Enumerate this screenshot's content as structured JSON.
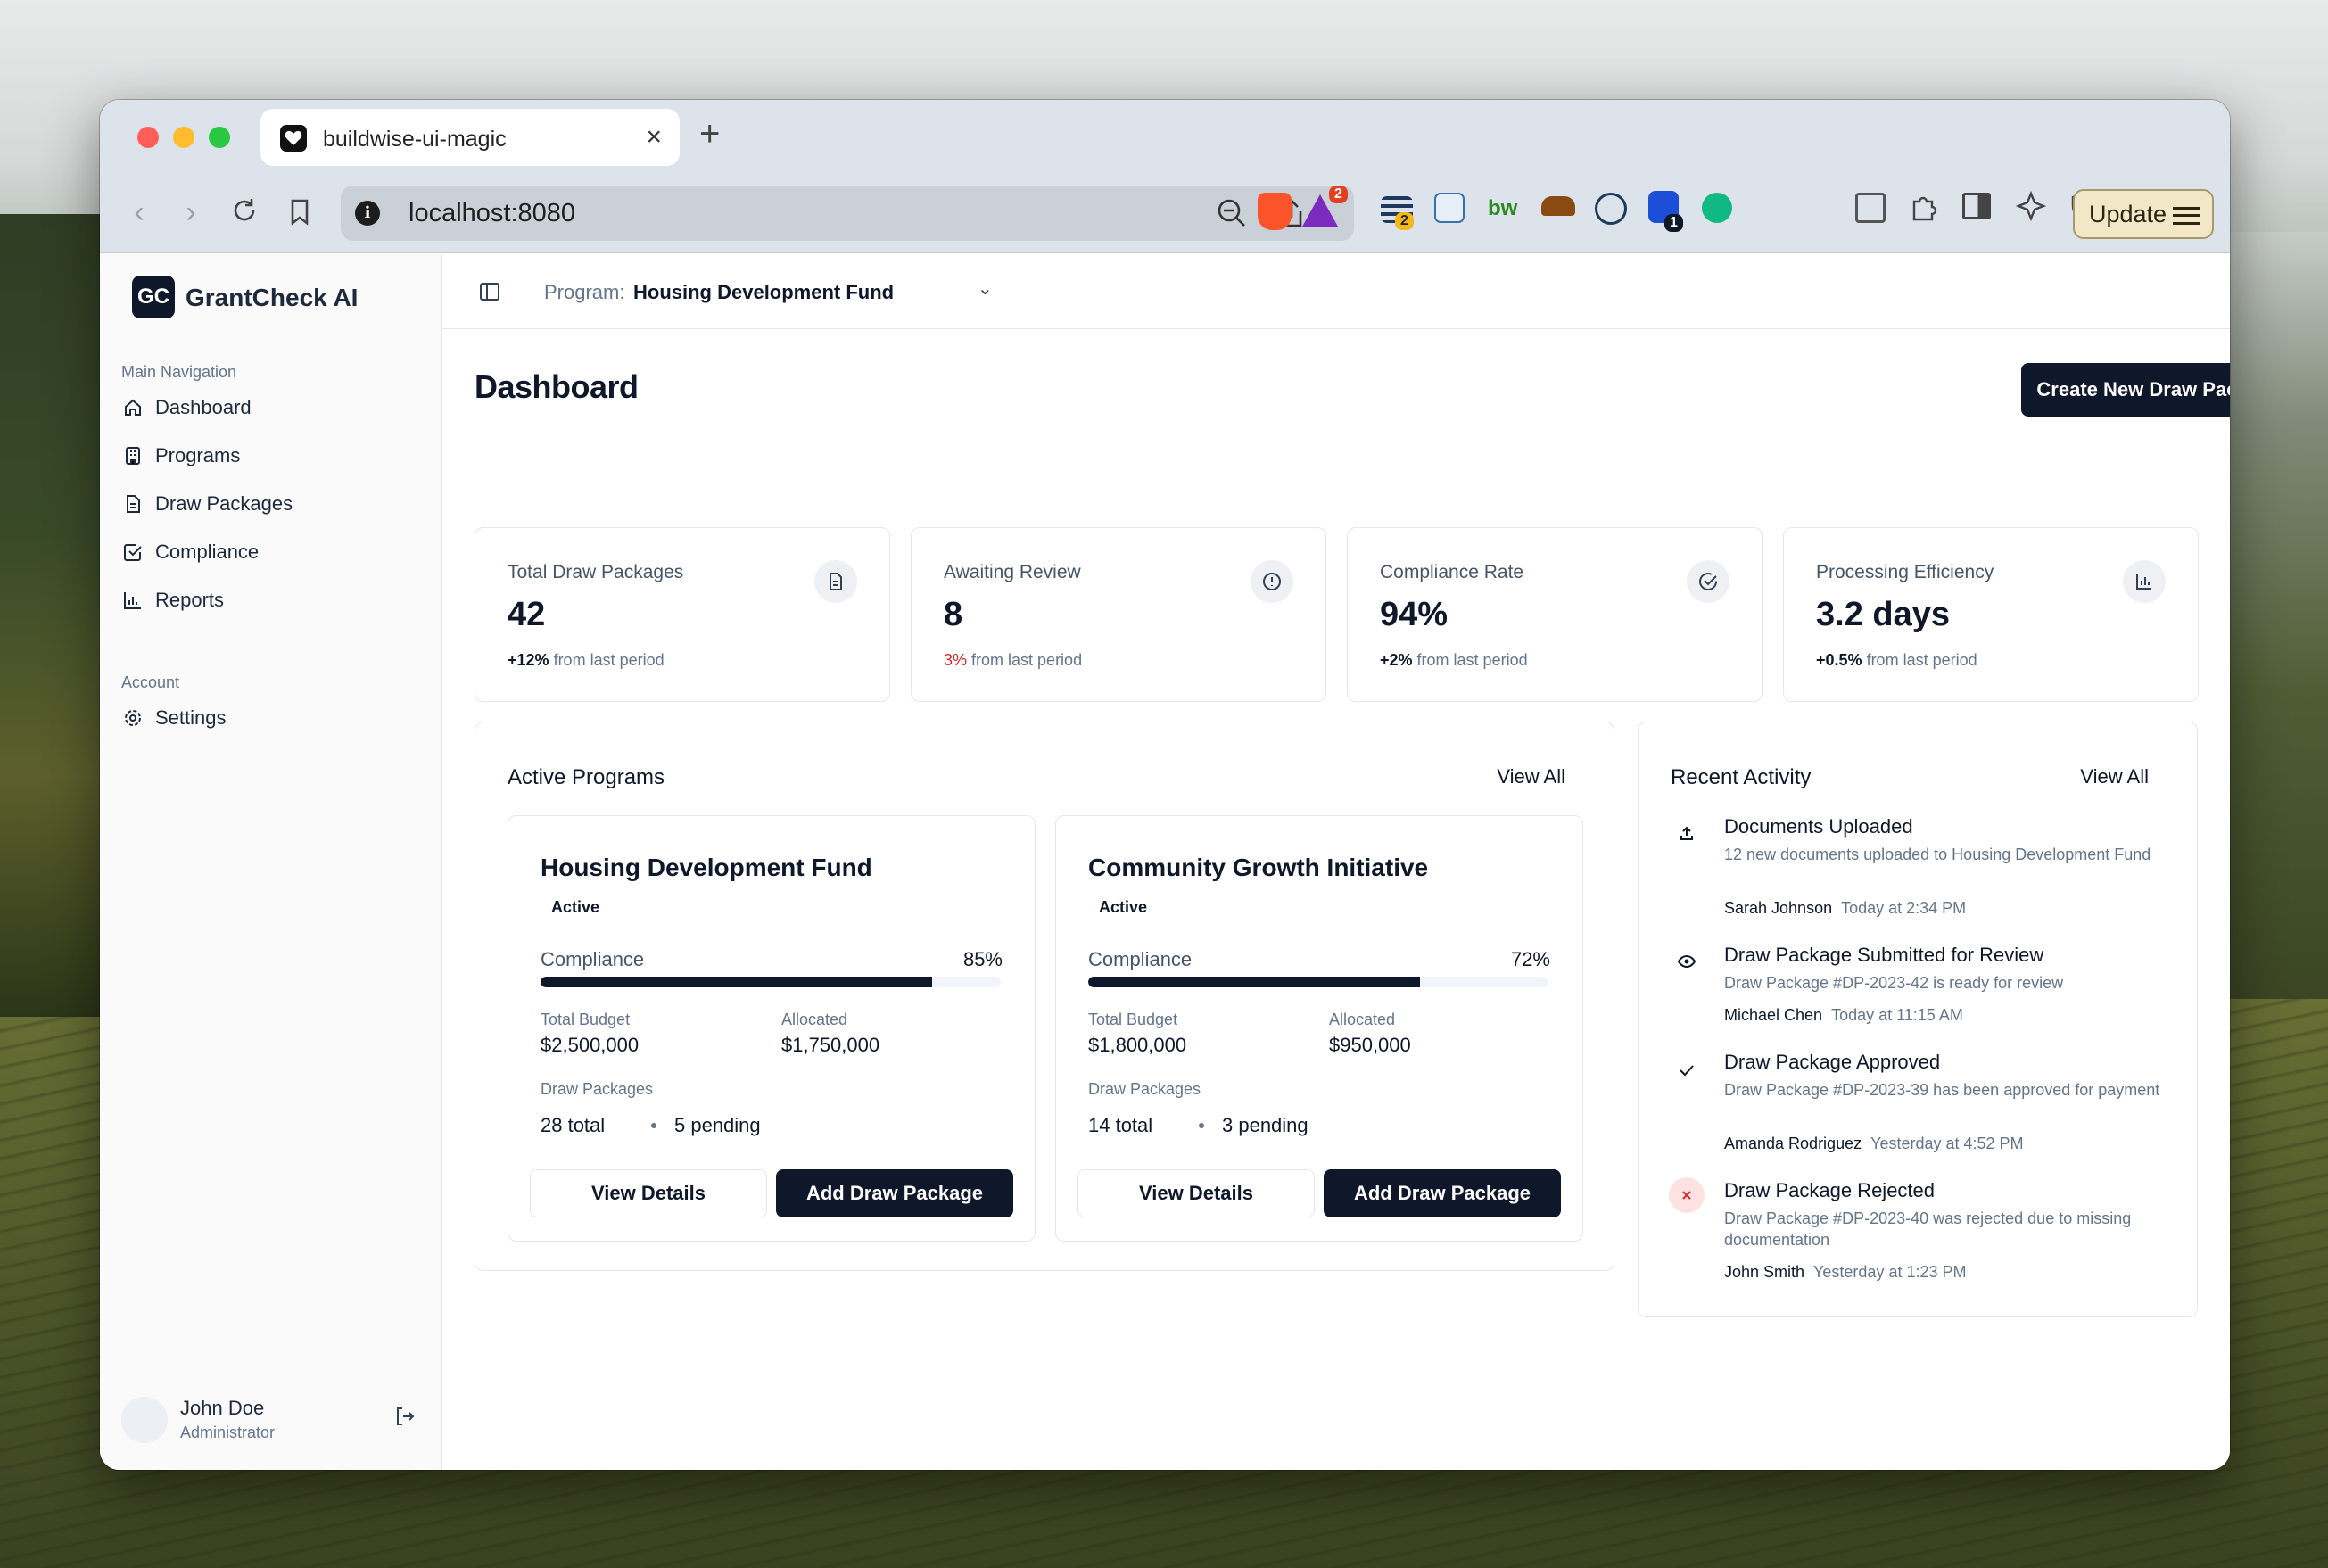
{
  "browser": {
    "tab_title": "buildwise-ui-magic",
    "url": "localhost:8080",
    "ext_badge_1": "2",
    "ext_badge_2": "2",
    "ext_badge_3": "1",
    "update_label": "Update"
  },
  "sidebar": {
    "logo_initials": "GC",
    "brand": "GrantCheck AI",
    "section_main": "Main Navigation",
    "items": [
      {
        "label": "Dashboard",
        "icon": "home-icon"
      },
      {
        "label": "Programs",
        "icon": "building-icon"
      },
      {
        "label": "Draw Packages",
        "icon": "file-icon"
      },
      {
        "label": "Compliance",
        "icon": "check-square-icon"
      },
      {
        "label": "Reports",
        "icon": "bar-chart-icon"
      }
    ],
    "section_account": "Account",
    "settings_label": "Settings",
    "user": {
      "name": "John Doe",
      "role": "Administrator"
    }
  },
  "topbar": {
    "program_label": "Program:",
    "program_value": "Housing Development Fund"
  },
  "page": {
    "title": "Dashboard",
    "create_button": "Create New Draw Package"
  },
  "stats": [
    {
      "label": "Total Draw Packages",
      "value": "42",
      "change": "+12%",
      "suffix": "from last period",
      "icon": "document-icon"
    },
    {
      "label": "Awaiting Review",
      "value": "8",
      "change": "3%",
      "suffix": "from last period",
      "icon": "alert-circle-icon"
    },
    {
      "label": "Compliance Rate",
      "value": "94%",
      "change": "+2%",
      "suffix": "from last period",
      "icon": "check-circle-icon"
    },
    {
      "label": "Processing Efficiency",
      "value": "3.2 days",
      "change": "+0.5%",
      "suffix": "from last period",
      "icon": "bar-chart-icon"
    }
  ],
  "active_programs": {
    "title": "Active Programs",
    "view_all": "View All",
    "programs": [
      {
        "name": "Housing Development Fund",
        "status": "Active",
        "compliance_label": "Compliance",
        "compliance_value": "85%",
        "compliance_pct": 85,
        "budget_label": "Total Budget",
        "budget": "$2,500,000",
        "allocated_label": "Allocated",
        "allocated": "$1,750,000",
        "draw_label": "Draw Packages",
        "draw_total": "28 total",
        "draw_pending": "5 pending",
        "view_details": "View Details",
        "add_draw": "Add Draw Package"
      },
      {
        "name": "Community Growth Initiative",
        "status": "Active",
        "compliance_label": "Compliance",
        "compliance_value": "72%",
        "compliance_pct": 72,
        "budget_label": "Total Budget",
        "budget": "$1,800,000",
        "allocated_label": "Allocated",
        "allocated": "$950,000",
        "draw_label": "Draw Packages",
        "draw_total": "14 total",
        "draw_pending": "3 pending",
        "view_details": "View Details",
        "add_draw": "Add Draw Package"
      }
    ]
  },
  "recent_activity": {
    "title": "Recent Activity",
    "view_all": "View All",
    "items": [
      {
        "title": "Documents Uploaded",
        "desc": "12 new documents uploaded to Housing Development Fund",
        "user": "Sarah Johnson",
        "time": "Today at 2:34 PM",
        "icon": "upload-icon"
      },
      {
        "title": "Draw Package Submitted for Review",
        "desc": "Draw Package #DP-2023-42 is ready for review",
        "user": "Michael Chen",
        "time": "Today at 11:15 AM",
        "icon": "eye-icon"
      },
      {
        "title": "Draw Package Approved",
        "desc": "Draw Package #DP-2023-39 has been approved for payment",
        "user": "Amanda Rodriguez",
        "time": "Yesterday at 4:52 PM",
        "icon": "check-icon"
      },
      {
        "title": "Draw Package Rejected",
        "desc": "Draw Package #DP-2023-40 was rejected due to missing documentation",
        "user": "John Smith",
        "time": "Yesterday at 1:23 PM",
        "icon": "x-icon"
      }
    ]
  },
  "colors": {
    "primary": "#0f172a",
    "negative": "#dc2626",
    "rejected_bg": "#fee2e2"
  }
}
